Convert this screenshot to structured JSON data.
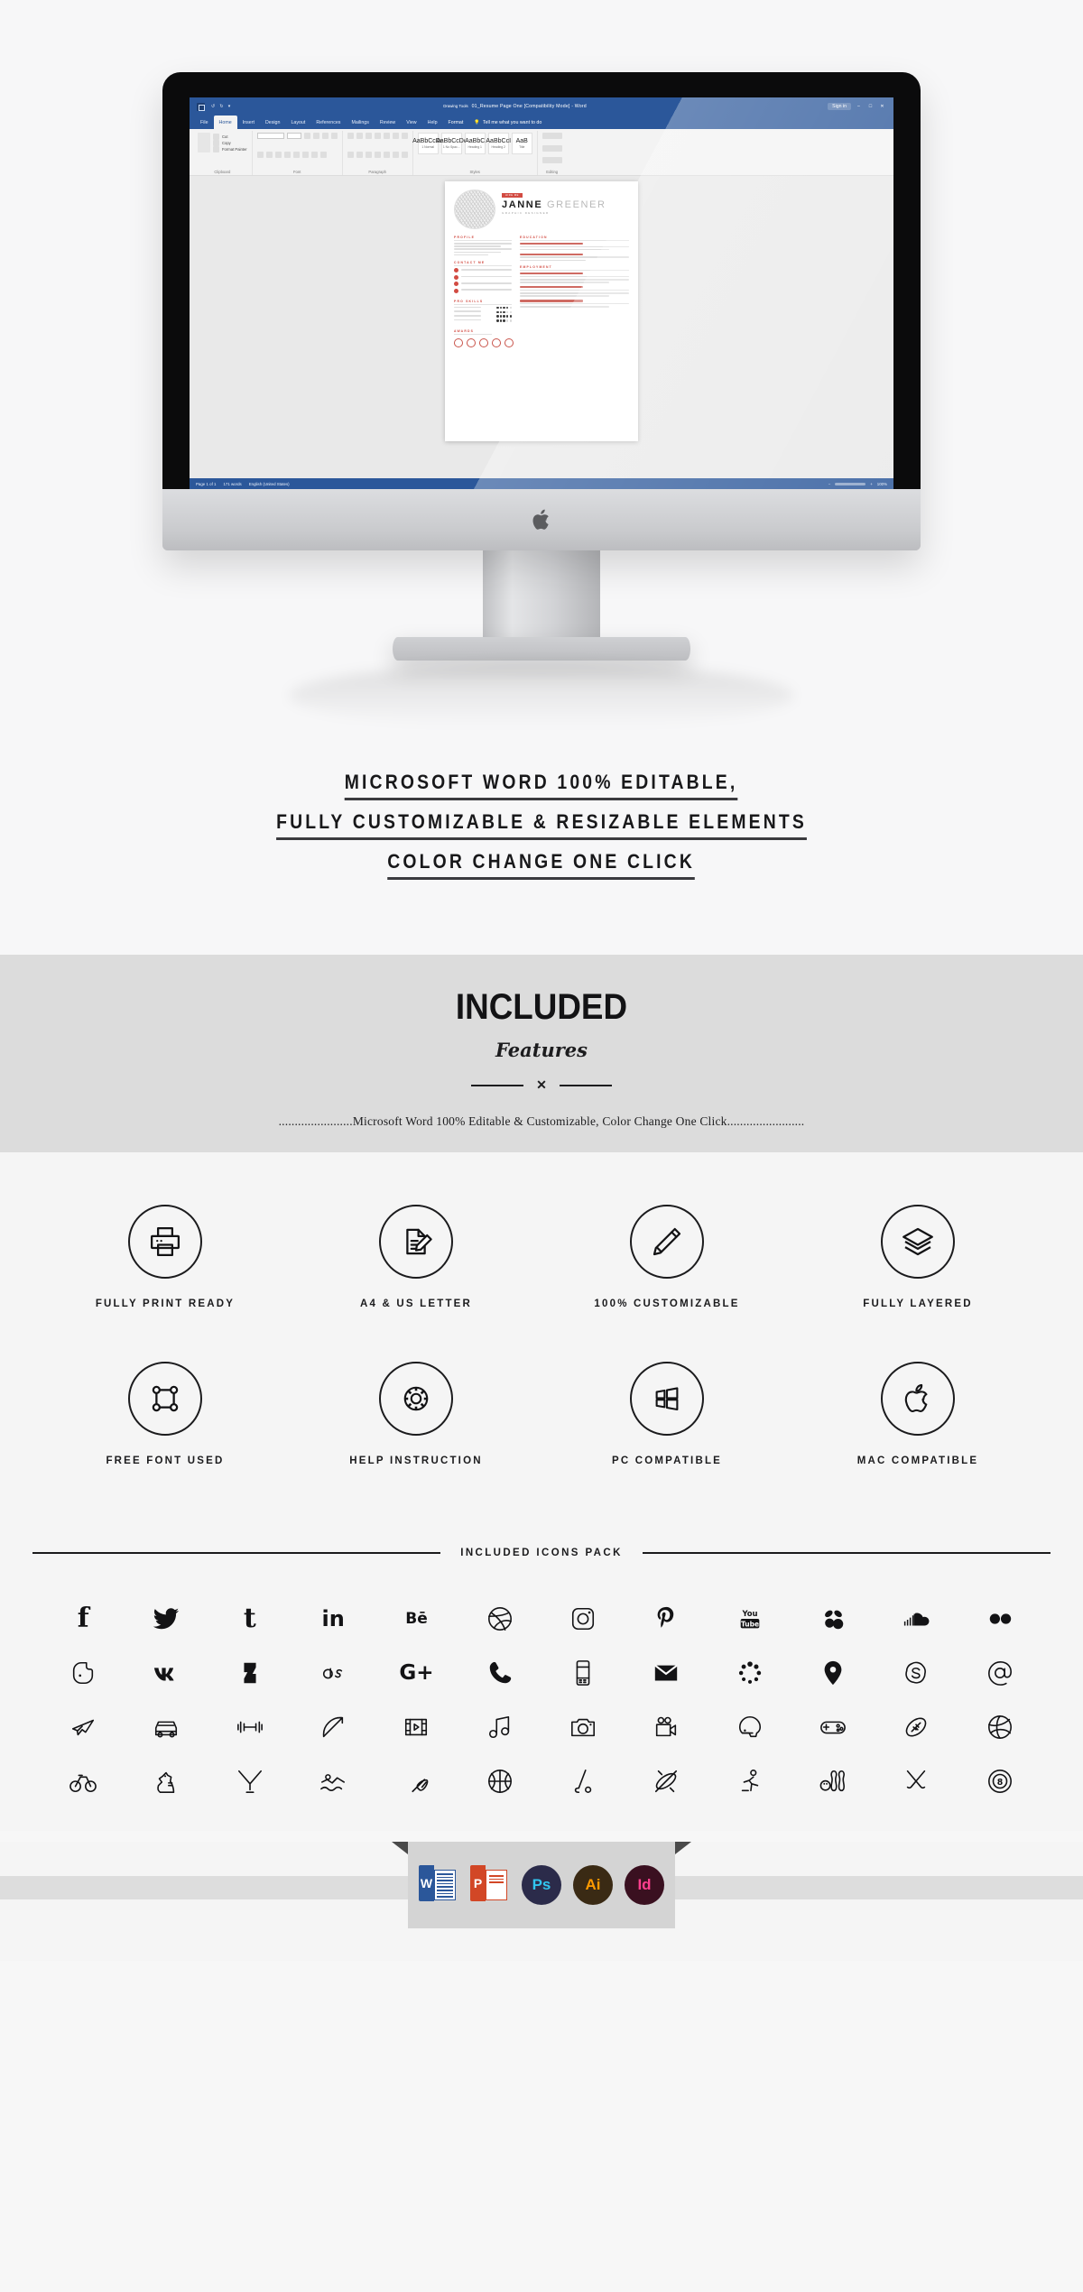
{
  "hero": {
    "word": {
      "doc_title": "01_Resume Page One [Compatibility Mode] - Word",
      "context_tab_label": "Drawing Tools",
      "tabs": [
        "File",
        "Home",
        "Insert",
        "Design",
        "Layout",
        "References",
        "Mailings",
        "Review",
        "View",
        "Help"
      ],
      "context_tab": "Format",
      "tell_me": "Tell me what you want to do",
      "sign_in": "Sign in",
      "groups": [
        "Clipboard",
        "Font",
        "Paragraph",
        "Styles",
        "Editing"
      ],
      "clipboard": {
        "paste": "Paste",
        "cut": "Cut",
        "copy": "Copy",
        "format_painter": "Format Painter"
      },
      "style_gallery": [
        {
          "sample": "AaBbCcDc",
          "name": "1 Normal"
        },
        {
          "sample": "AaBbCcDc",
          "name": "1 No Spac..."
        },
        {
          "sample": "AaBbC",
          "name": "Heading 1"
        },
        {
          "sample": "AaBbCcI",
          "name": "Heading 2"
        },
        {
          "sample": "AaB",
          "name": "Title"
        }
      ],
      "status": {
        "page": "Page 1 of 1",
        "words": "171 words",
        "lang": "English (United States)",
        "zoom": "100%"
      }
    },
    "resume": {
      "badge": "HIRE ME",
      "first_name": "JANNE",
      "last_name": "GREENER",
      "role": "GRAPHIC DESIGNER",
      "sections": {
        "profile": "PROFILE",
        "education": "EDUCATION",
        "employment": "EMPLOYMENT",
        "contact": "CONTACT ME",
        "skills": "PRO SKILLS",
        "awards": "AWARDS"
      }
    }
  },
  "headline": {
    "lines": [
      "MICROSOFT WORD 100% EDITABLE,",
      "FULLY CUSTOMIZABLE & RESIZABLE ELEMENTS",
      "COLOR CHANGE ONE CLICK"
    ]
  },
  "included": {
    "title": "INCLUDED",
    "subtitle": "Features",
    "ornament": "✕",
    "note": ".......................Microsoft Word 100% Editable & Customizable, Color Change One Click........................"
  },
  "features": [
    {
      "icon": "printer-icon",
      "label": "FULLY PRINT READY"
    },
    {
      "icon": "document-edit-icon",
      "label": "A4 & US LETTER"
    },
    {
      "icon": "pencil-icon",
      "label": "100% CUSTOMIZABLE"
    },
    {
      "icon": "layers-icon",
      "label": "FULLY LAYERED"
    },
    {
      "icon": "node-frame-icon",
      "label": "FREE FONT USED"
    },
    {
      "icon": "lifebuoy-icon",
      "label": "HELP INSTRUCTION"
    },
    {
      "icon": "windows-icon",
      "label": "PC COMPATIBLE"
    },
    {
      "icon": "apple-icon",
      "label": "MAC COMPATIBLE"
    }
  ],
  "icon_pack": {
    "title": "INCLUDED ICONS PACK",
    "rows": [
      [
        "facebook-icon",
        "twitter-icon",
        "tumblr-icon",
        "linkedin-icon",
        "behance-icon",
        "dribbble-icon",
        "instagram-icon",
        "pinterest-icon",
        "youtube-icon",
        "swarm-icon",
        "soundcloud-icon",
        "flickr-icon"
      ],
      [
        "blogger-icon",
        "vk-icon",
        "deviantart-icon",
        "lastfm-icon",
        "google-plus-icon",
        "phone-icon",
        "mobile-icon",
        "email-icon",
        "web-icon",
        "location-icon",
        "skype-icon",
        "at-icon"
      ],
      [
        "airplane-icon",
        "car-icon",
        "dumbbell-icon",
        "archery-icon",
        "film-icon",
        "music-icon",
        "camera-icon",
        "video-camera-icon",
        "football-helmet-icon",
        "gamepad-icon",
        "american-football-icon",
        "volleyball-icon"
      ],
      [
        "bicycle-icon",
        "chess-knight-icon",
        "fencing-icon",
        "swimming-icon",
        "badminton-icon",
        "basketball-icon",
        "golf-icon",
        "kayak-icon",
        "running-icon",
        "bowling-icon",
        "hockey-icon",
        "billiards-icon"
      ]
    ]
  },
  "software": [
    {
      "name": "word-icon",
      "letter": "W",
      "color": "#2b579a"
    },
    {
      "name": "powerpoint-icon",
      "letter": "P",
      "color": "#d24726"
    },
    {
      "name": "photoshop-icon",
      "letter": "Ps",
      "color": "#2b2b4a",
      "text_color": "#31c5f0"
    },
    {
      "name": "illustrator-icon",
      "letter": "Ai",
      "color": "#3a2a14",
      "text_color": "#ff9a00"
    },
    {
      "name": "indesign-icon",
      "letter": "Id",
      "color": "#3a1020",
      "text_color": "#ff3f8e"
    }
  ]
}
